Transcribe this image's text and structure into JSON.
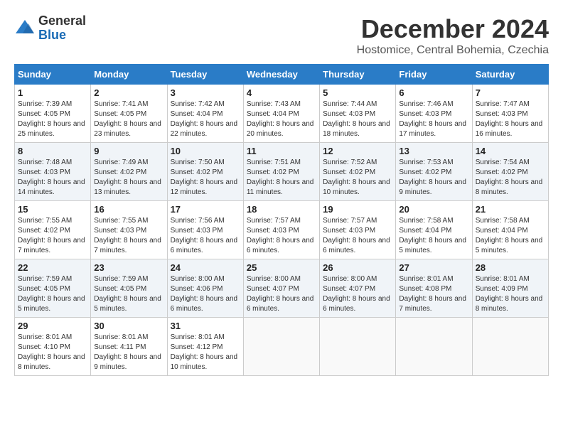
{
  "header": {
    "logo_line1": "General",
    "logo_line2": "Blue",
    "month": "December 2024",
    "location": "Hostomice, Central Bohemia, Czechia"
  },
  "weekdays": [
    "Sunday",
    "Monday",
    "Tuesday",
    "Wednesday",
    "Thursday",
    "Friday",
    "Saturday"
  ],
  "weeks": [
    [
      {
        "day": "1",
        "sunrise": "Sunrise: 7:39 AM",
        "sunset": "Sunset: 4:05 PM",
        "daylight": "Daylight: 8 hours and 25 minutes."
      },
      {
        "day": "2",
        "sunrise": "Sunrise: 7:41 AM",
        "sunset": "Sunset: 4:05 PM",
        "daylight": "Daylight: 8 hours and 23 minutes."
      },
      {
        "day": "3",
        "sunrise": "Sunrise: 7:42 AM",
        "sunset": "Sunset: 4:04 PM",
        "daylight": "Daylight: 8 hours and 22 minutes."
      },
      {
        "day": "4",
        "sunrise": "Sunrise: 7:43 AM",
        "sunset": "Sunset: 4:04 PM",
        "daylight": "Daylight: 8 hours and 20 minutes."
      },
      {
        "day": "5",
        "sunrise": "Sunrise: 7:44 AM",
        "sunset": "Sunset: 4:03 PM",
        "daylight": "Daylight: 8 hours and 18 minutes."
      },
      {
        "day": "6",
        "sunrise": "Sunrise: 7:46 AM",
        "sunset": "Sunset: 4:03 PM",
        "daylight": "Daylight: 8 hours and 17 minutes."
      },
      {
        "day": "7",
        "sunrise": "Sunrise: 7:47 AM",
        "sunset": "Sunset: 4:03 PM",
        "daylight": "Daylight: 8 hours and 16 minutes."
      }
    ],
    [
      {
        "day": "8",
        "sunrise": "Sunrise: 7:48 AM",
        "sunset": "Sunset: 4:03 PM",
        "daylight": "Daylight: 8 hours and 14 minutes."
      },
      {
        "day": "9",
        "sunrise": "Sunrise: 7:49 AM",
        "sunset": "Sunset: 4:02 PM",
        "daylight": "Daylight: 8 hours and 13 minutes."
      },
      {
        "day": "10",
        "sunrise": "Sunrise: 7:50 AM",
        "sunset": "Sunset: 4:02 PM",
        "daylight": "Daylight: 8 hours and 12 minutes."
      },
      {
        "day": "11",
        "sunrise": "Sunrise: 7:51 AM",
        "sunset": "Sunset: 4:02 PM",
        "daylight": "Daylight: 8 hours and 11 minutes."
      },
      {
        "day": "12",
        "sunrise": "Sunrise: 7:52 AM",
        "sunset": "Sunset: 4:02 PM",
        "daylight": "Daylight: 8 hours and 10 minutes."
      },
      {
        "day": "13",
        "sunrise": "Sunrise: 7:53 AM",
        "sunset": "Sunset: 4:02 PM",
        "daylight": "Daylight: 8 hours and 9 minutes."
      },
      {
        "day": "14",
        "sunrise": "Sunrise: 7:54 AM",
        "sunset": "Sunset: 4:02 PM",
        "daylight": "Daylight: 8 hours and 8 minutes."
      }
    ],
    [
      {
        "day": "15",
        "sunrise": "Sunrise: 7:55 AM",
        "sunset": "Sunset: 4:02 PM",
        "daylight": "Daylight: 8 hours and 7 minutes."
      },
      {
        "day": "16",
        "sunrise": "Sunrise: 7:55 AM",
        "sunset": "Sunset: 4:03 PM",
        "daylight": "Daylight: 8 hours and 7 minutes."
      },
      {
        "day": "17",
        "sunrise": "Sunrise: 7:56 AM",
        "sunset": "Sunset: 4:03 PM",
        "daylight": "Daylight: 8 hours and 6 minutes."
      },
      {
        "day": "18",
        "sunrise": "Sunrise: 7:57 AM",
        "sunset": "Sunset: 4:03 PM",
        "daylight": "Daylight: 8 hours and 6 minutes."
      },
      {
        "day": "19",
        "sunrise": "Sunrise: 7:57 AM",
        "sunset": "Sunset: 4:03 PM",
        "daylight": "Daylight: 8 hours and 6 minutes."
      },
      {
        "day": "20",
        "sunrise": "Sunrise: 7:58 AM",
        "sunset": "Sunset: 4:04 PM",
        "daylight": "Daylight: 8 hours and 5 minutes."
      },
      {
        "day": "21",
        "sunrise": "Sunrise: 7:58 AM",
        "sunset": "Sunset: 4:04 PM",
        "daylight": "Daylight: 8 hours and 5 minutes."
      }
    ],
    [
      {
        "day": "22",
        "sunrise": "Sunrise: 7:59 AM",
        "sunset": "Sunset: 4:05 PM",
        "daylight": "Daylight: 8 hours and 5 minutes."
      },
      {
        "day": "23",
        "sunrise": "Sunrise: 7:59 AM",
        "sunset": "Sunset: 4:05 PM",
        "daylight": "Daylight: 8 hours and 5 minutes."
      },
      {
        "day": "24",
        "sunrise": "Sunrise: 8:00 AM",
        "sunset": "Sunset: 4:06 PM",
        "daylight": "Daylight: 8 hours and 6 minutes."
      },
      {
        "day": "25",
        "sunrise": "Sunrise: 8:00 AM",
        "sunset": "Sunset: 4:07 PM",
        "daylight": "Daylight: 8 hours and 6 minutes."
      },
      {
        "day": "26",
        "sunrise": "Sunrise: 8:00 AM",
        "sunset": "Sunset: 4:07 PM",
        "daylight": "Daylight: 8 hours and 6 minutes."
      },
      {
        "day": "27",
        "sunrise": "Sunrise: 8:01 AM",
        "sunset": "Sunset: 4:08 PM",
        "daylight": "Daylight: 8 hours and 7 minutes."
      },
      {
        "day": "28",
        "sunrise": "Sunrise: 8:01 AM",
        "sunset": "Sunset: 4:09 PM",
        "daylight": "Daylight: 8 hours and 8 minutes."
      }
    ],
    [
      {
        "day": "29",
        "sunrise": "Sunrise: 8:01 AM",
        "sunset": "Sunset: 4:10 PM",
        "daylight": "Daylight: 8 hours and 8 minutes."
      },
      {
        "day": "30",
        "sunrise": "Sunrise: 8:01 AM",
        "sunset": "Sunset: 4:11 PM",
        "daylight": "Daylight: 8 hours and 9 minutes."
      },
      {
        "day": "31",
        "sunrise": "Sunrise: 8:01 AM",
        "sunset": "Sunset: 4:12 PM",
        "daylight": "Daylight: 8 hours and 10 minutes."
      },
      null,
      null,
      null,
      null
    ]
  ]
}
